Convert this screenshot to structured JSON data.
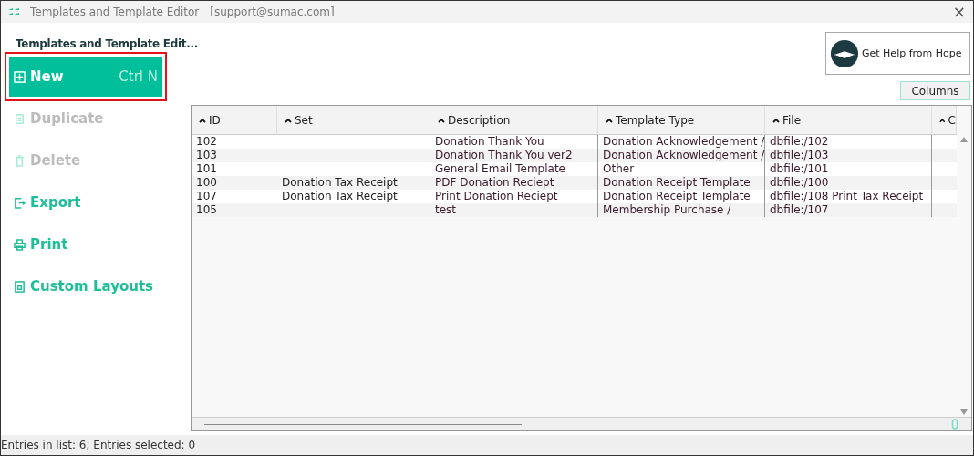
{
  "window": {
    "title": "Templates and Template Editor",
    "account": "[support@sumac.com]",
    "close": "×"
  },
  "sidebar": {
    "title": "Templates and Template Edit...",
    "items": [
      {
        "label": "New",
        "shortcut": "Ctrl N",
        "selected": true,
        "disabled": false,
        "kind": "plus"
      },
      {
        "label": "Duplicate",
        "selected": false,
        "disabled": true,
        "kind": "copy"
      },
      {
        "label": "Delete",
        "selected": false,
        "disabled": true,
        "kind": "trash"
      },
      {
        "label": "Export",
        "selected": false,
        "disabled": false,
        "kind": "export"
      },
      {
        "label": "Print",
        "selected": false,
        "disabled": false,
        "kind": "print"
      },
      {
        "label": "Custom Layouts",
        "selected": false,
        "disabled": false,
        "kind": "layout"
      }
    ]
  },
  "help_button": {
    "label": "Get Help from Hope"
  },
  "columns_button": {
    "label": "Columns"
  },
  "table": {
    "columns": [
      "ID",
      "Set",
      "Description",
      "Template Type",
      "File",
      "C"
    ],
    "rows": [
      [
        "102",
        "",
        "Donation Thank You",
        "Donation Acknowledgement /",
        "dbfile:/102",
        ""
      ],
      [
        "103",
        "",
        "Donation Thank You ver2",
        "Donation Acknowledgement /",
        "dbfile:/103",
        ""
      ],
      [
        "101",
        "",
        "General Email Template",
        "Other",
        "dbfile:/101",
        ""
      ],
      [
        "100",
        "Donation Tax Receipt",
        "PDF Donation Reciept",
        "Donation Receipt Template",
        "dbfile:/100",
        ""
      ],
      [
        "107",
        "Donation Tax Receipt",
        "Print Donation Reciept",
        "Donation Receipt Template",
        "dbfile:/108 Print Tax Receipt",
        ""
      ],
      [
        "105",
        "",
        "test",
        "Membership Purchase /",
        "dbfile:/107",
        ""
      ]
    ]
  },
  "status_bar": "Entries in list: 6; Entries selected: 0"
}
